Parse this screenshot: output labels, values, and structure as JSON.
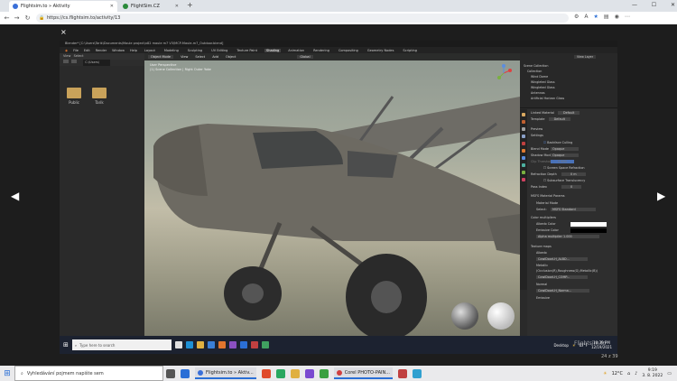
{
  "browser": {
    "tabs": [
      {
        "title": "Flightsim.to » Aktivity",
        "active": true
      },
      {
        "title": "FlightSim.CZ",
        "active": false
      }
    ],
    "new_tab_glyph": "+",
    "url": "https://cs.flightsim.to/activity/13"
  },
  "viewer": {
    "close_glyph": "×",
    "prev_glyph": "◀",
    "next_glyph": "▶",
    "counter": "24 z 39"
  },
  "blender": {
    "title_path": "Blender* [C:\\Users\\Tarik\\Documents\\Maule project\\x82 maule m7 V3\\MCP-Maule-m7_Outdoor.blend]",
    "menu": [
      "File",
      "Edit",
      "Render",
      "Window",
      "Help"
    ],
    "workspaces": [
      "Layout",
      "Modeling",
      "Sculpting",
      "UV Editing",
      "Texture Paint",
      "Shading",
      "Animation",
      "Rendering",
      "Compositing",
      "Geometry Nodes",
      "Scripting"
    ],
    "active_workspace": "Shading",
    "file_browser": {
      "header": [
        "View",
        "Select"
      ],
      "path": "C:\\Users\\",
      "folders": [
        "Public",
        "Tarik"
      ]
    },
    "viewport": {
      "header": [
        "Object Mode",
        "View",
        "Select",
        "Add",
        "Object"
      ],
      "transform": "Global",
      "info_line1": "User Perspective",
      "info_line2": "(1) Scene Collection | Right Outer Yoke"
    },
    "outliner": {
      "header": "View Layer",
      "rows": [
        "Scene Collection",
        "Collection",
        "Wind Dome",
        "Wingleted Glass",
        "Wingleted Glass",
        "Antennas",
        "Artificial Horizon Glass"
      ]
    },
    "properties": {
      "rows": [
        {
          "label": "Linked Material",
          "value": "Default"
        },
        {
          "label": "Template",
          "value": "Default"
        }
      ],
      "sections": [
        "Preview",
        "Settings"
      ],
      "settings": [
        {
          "label": "Backface Culling",
          "value": ""
        },
        {
          "label": "Blend Mode",
          "value": "Opaque"
        },
        {
          "label": "Shadow Mode",
          "value": "Opaque"
        },
        {
          "label": "Clip Threshold",
          "value": "0.500"
        },
        {
          "label": "Screen Space Refraction",
          "value": ""
        },
        {
          "label": "Refraction Depth",
          "value": "0 m"
        },
        {
          "label": "Subsurface Translucency",
          "value": ""
        },
        {
          "label": "Pass Index",
          "value": "0"
        }
      ],
      "msfs_header": "MSFS Material Params",
      "material_mode_label": "Material Mode",
      "select_label": "Select:",
      "select_value": "MSFS Standard",
      "color_multipliers": "Color multipliers",
      "albedo_label": "Albedo Color",
      "emissive_label": "Emissive Color",
      "alpha_label": "Alpha multiplier",
      "alpha_value": "1.000",
      "texture_maps": "Texture maps",
      "albedo_map": "Albedo",
      "albedo_file": "CowlDoorLH_ALBD...",
      "metallic_label": "Metallic",
      "metallic_note": "(Occlusion(R),Roughness(G),Metallic(B))",
      "metallic_file": "CowlDoorLH_COMP...",
      "normal_label": "Normal",
      "normal_file": "CowlDoorLH_Norma...",
      "emissive_map": "Emissive"
    },
    "taskbar": {
      "search_placeholder": "Type here to search",
      "desktop": "Desktop",
      "temp": "67°F",
      "time": "10:39 PM",
      "date": "12/19/2021"
    }
  },
  "taskbar": {
    "search_placeholder": "Vyhledávání pojmem napište sem",
    "apps": [
      "Flightsim.to » Aktiv...",
      "Corel PHOTO-PAIN..."
    ],
    "temperature": "12°C",
    "time": "9:19",
    "date": "3. 8. 2022"
  },
  "watermark": "Flightsim.to",
  "colors": {
    "accent_blue": "#2b6fd6",
    "blender_orange": "#e0752d",
    "folder": "#c9a25a"
  }
}
